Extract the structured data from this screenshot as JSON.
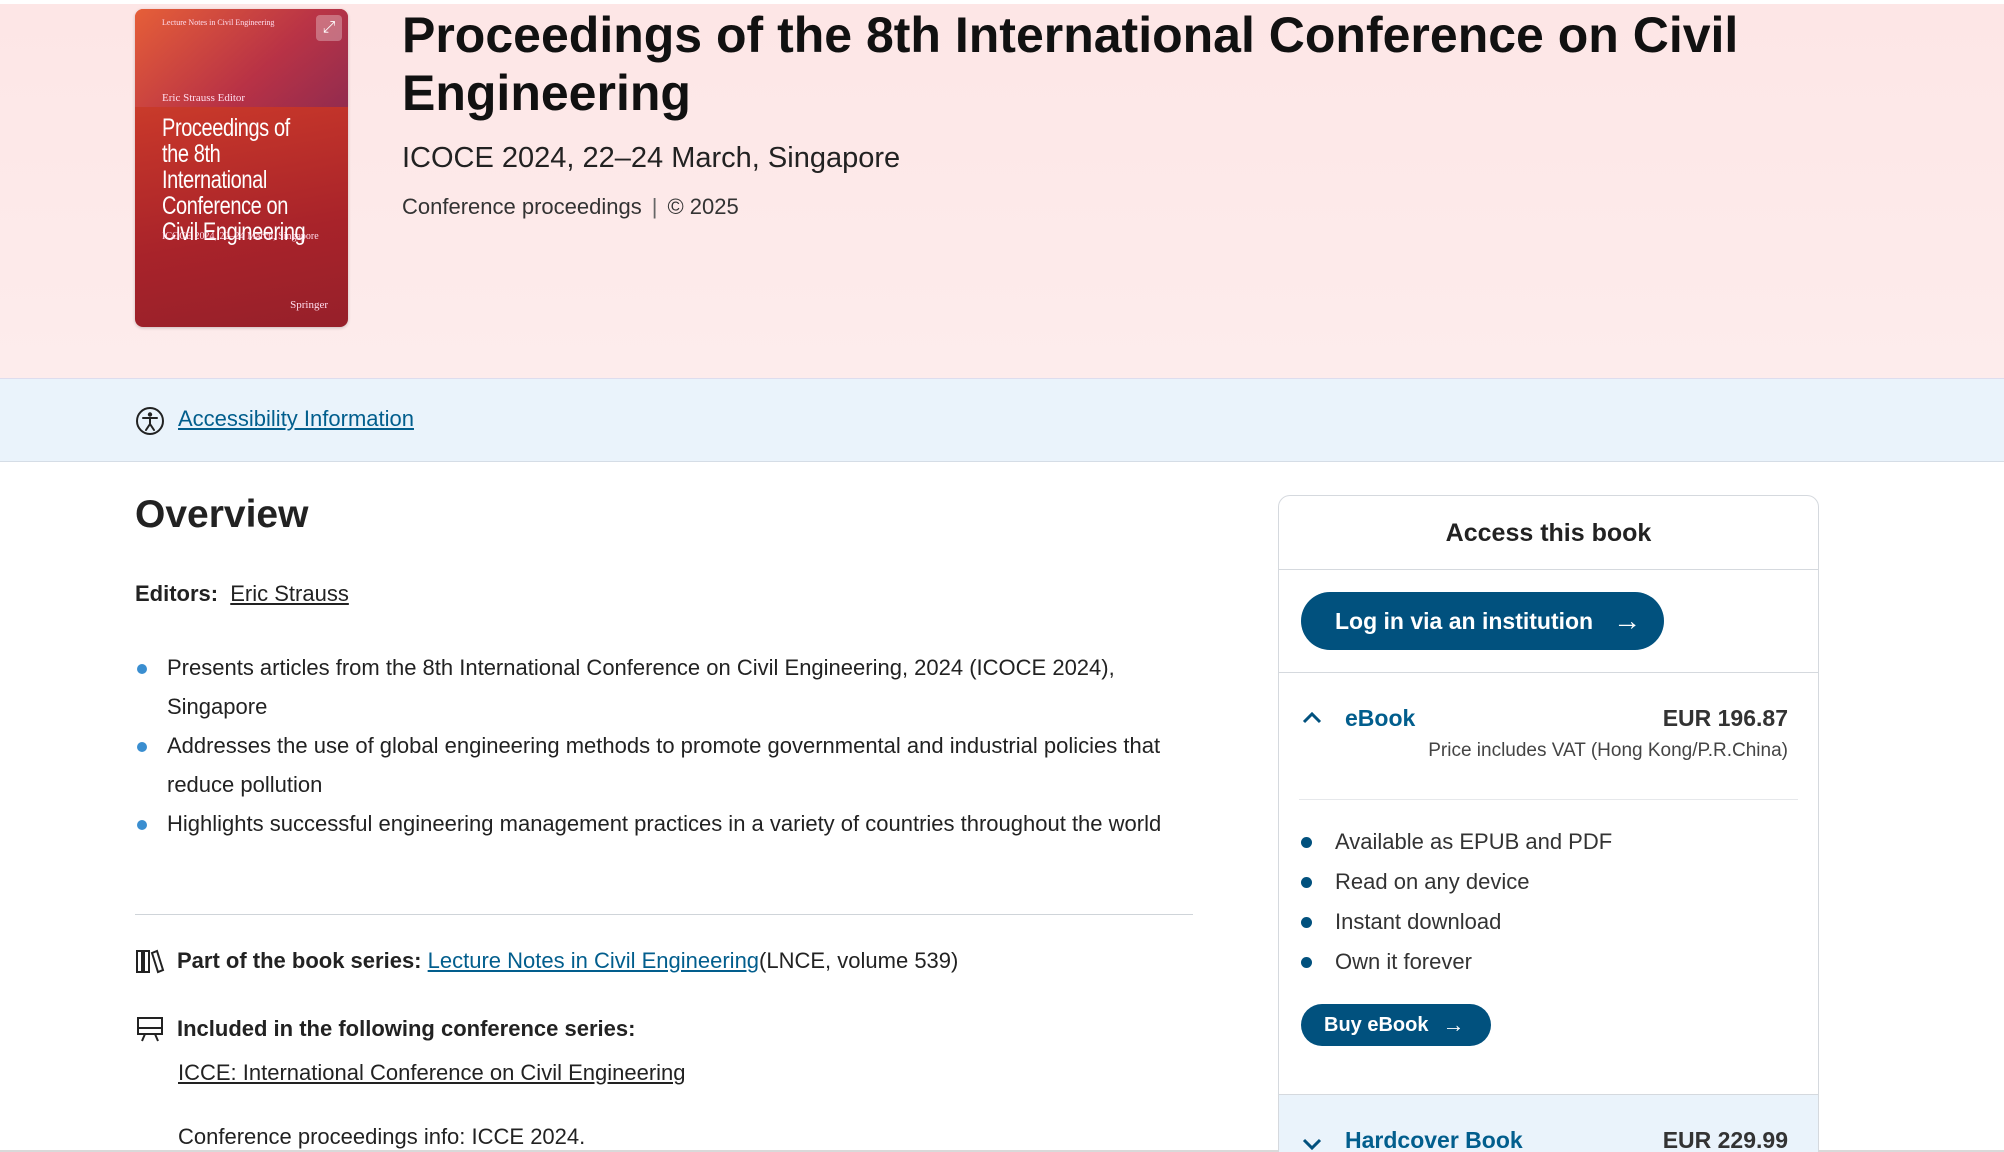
{
  "cover": {
    "series": "Lecture Notes in Civil Engineering",
    "editor": "Eric Strauss  Editor",
    "title": "Proceedings of the 8th International Conference on Civil Engineering",
    "subtitle": "ICOCE 2024, 22–24 March, Singapore",
    "publisher": "Springer"
  },
  "header": {
    "title": "Proceedings of the 8th International Conference on Civil Engineering",
    "subtitle": "ICOCE 2024, 22–24 March, Singapore",
    "type": "Conference proceedings",
    "separator": "|",
    "copyright": "© 2025"
  },
  "accessibility": {
    "link": "Accessibility Information"
  },
  "overview": {
    "heading": "Overview",
    "editors_label": "Editors:",
    "editor_name": "Eric Strauss",
    "bullets": [
      "Presents articles from the 8th International Conference on Civil Engineering, 2024 (ICOCE 2024), Singapore",
      "Addresses the use of global engineering methods to promote governmental and industrial policies that reduce pollution",
      "Highlights successful engineering management practices in a variety of countries throughout the world"
    ],
    "series_label": "Part of the book series:",
    "series_link": "Lecture Notes in Civil Engineering",
    "series_suffix": " (LNCE, volume 539)",
    "conf_label": "Included in the following conference series:",
    "conf_link": "ICCE: International Conference on Civil Engineering",
    "conf_info": "Conference proceedings info: ICCE 2024."
  },
  "panel": {
    "heading": "Access this book",
    "login_button": "Log in via an institution",
    "ebook_label": "eBook",
    "ebook_price": "EUR 196.87",
    "ebook_vat": "Price includes VAT (Hong Kong/P.R.China)",
    "features": [
      "Available as EPUB and PDF",
      "Read on any device",
      "Instant download",
      "Own it forever"
    ],
    "buy_button": "Buy eBook",
    "hardcover_label": "Hardcover Book",
    "hardcover_price": "EUR 229.99"
  },
  "colors": {
    "link": "#025e8d",
    "button": "#01517e",
    "hero_bg": "#fde6e6",
    "access_bar_bg": "#eaf3fb"
  }
}
